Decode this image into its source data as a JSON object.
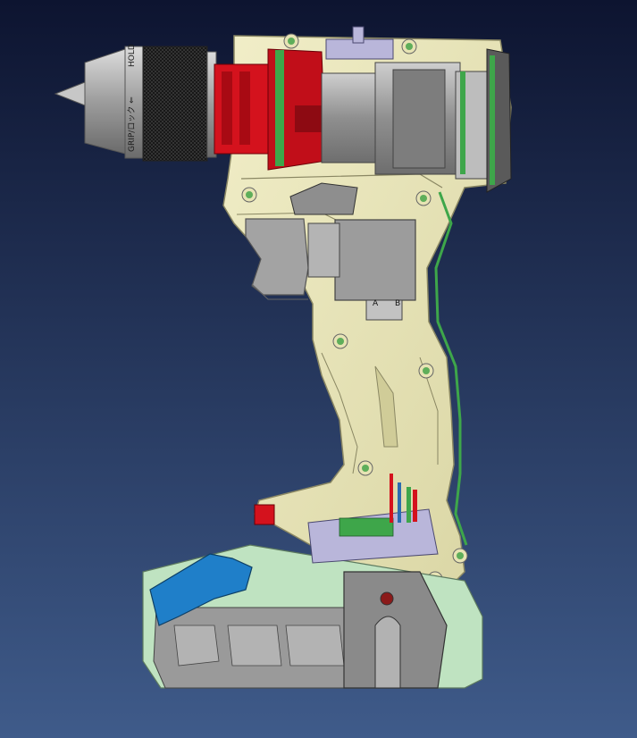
{
  "viewport": {
    "background_top": "#0d1430",
    "background_bottom": "#3f5b8a"
  },
  "colors": {
    "housing": "#e7e3b4",
    "housing_edge": "#8a8763",
    "chuck_body": "#b9b9b9",
    "chuck_grip": "#2b2b2b",
    "gearbox_red": "#d4121d",
    "green_parts": "#3ea64a",
    "motor_grey": "#a8a8a8",
    "lavender": "#b9b6da",
    "blue_latch": "#1f7fc9",
    "battery_grey": "#9a9a9a",
    "battery_green": "#bfe3c1",
    "screw_green": "#5fae5a"
  },
  "labels": {
    "chuck_text": "GRIP/ロック ⇐ ",
    "chuck_text_2": "HOLD",
    "switch_a": "A",
    "switch_b": "B"
  },
  "icons": {
    "screw": "screw-boss-icon"
  }
}
